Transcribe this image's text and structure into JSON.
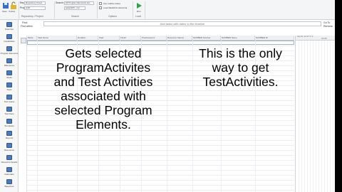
{
  "ribbon": {
    "buttons": [
      {
        "label": "Save",
        "color": "#3a6fc4"
      },
      {
        "label": "Unlock",
        "color": "#e0b531"
      }
    ],
    "repository_label": "Repository:",
    "repository_value": "Repository Cloud",
    "project_label": "Project:",
    "project_value": "Artifi",
    "search_label": "Search:",
    "search_value": "All Program Elements sel...",
    "mode_value": "selectKPI - not...",
    "checkbox1_label": "Use relative dates",
    "checkbox2_label": "Load SEARCH Historical",
    "run_label": "Run",
    "groups": [
      "Repository / Project",
      "Search",
      "Options",
      "Load"
    ]
  },
  "nav": {
    "items": [
      "Data Set",
      "Capabilities",
      "Program Elements",
      "Milestones",
      "Tasks",
      "Tests",
      "Test Cases",
      "Test Runs",
      "Templates",
      "Reports",
      "Resources",
      "Resource Details",
      "Calendars",
      "Baselines"
    ]
  },
  "filter": {
    "label_top": "Find:",
    "label_bottom": "Find within",
    "banner": "Add tasks with dates to the timeline",
    "side_top": "Go To",
    "side_bottom": "Remove"
  },
  "grid": {
    "columns": [
      "Mode",
      "Task Name",
      "Duration",
      "Start",
      "Finish",
      "Predecessors",
      "Resource Names",
      "NUMBER Number",
      "NUMBER Name",
      "NUMBER ID"
    ]
  },
  "gantt": {
    "head_top": "Sep 09, '12 W T F S",
    "head_bottom": "Oct 08"
  },
  "annotations": {
    "left": [
      "Gets selected",
      "ProgramActivites",
      "and Test Activities",
      "associated with",
      "selected Program",
      "Elements."
    ],
    "right": [
      "This is the only",
      "way to get",
      "TestActivities."
    ]
  },
  "colors": {
    "nav_icon": "#4e79b7",
    "ribbon_bg": "#f4f5f7",
    "grid_line": "#eceef1"
  }
}
